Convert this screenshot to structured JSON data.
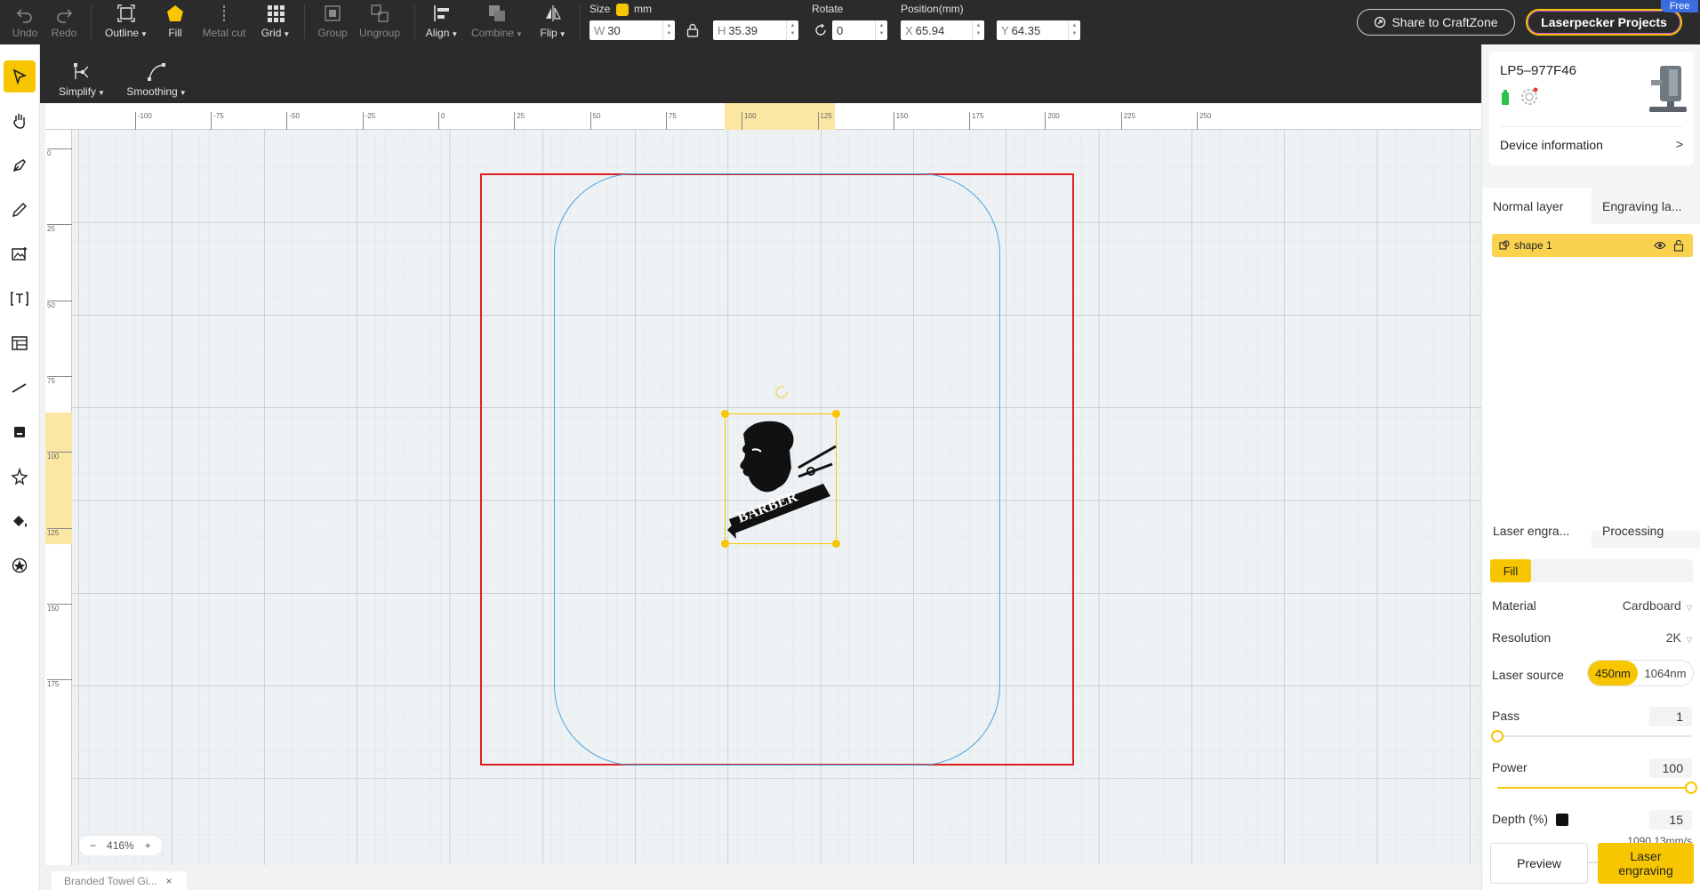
{
  "toolbar": {
    "undo": "Undo",
    "redo": "Redo",
    "outline": "Outline",
    "fill": "Fill",
    "metal_cut": "Metal cut",
    "grid": "Grid",
    "group": "Group",
    "ungroup": "Ungroup",
    "align": "Align",
    "combine": "Combine",
    "flip": "Flip",
    "size_label": "Size",
    "size_unit": "mm",
    "width_prefix": "W",
    "width_value": "30",
    "height_prefix": "H",
    "height_value": "35.39",
    "rotate_label": "Rotate",
    "rotate_value": "0",
    "position_label": "Position(mm)",
    "x_prefix": "X",
    "x_value": "65.94",
    "y_prefix": "Y",
    "y_value": "64.35",
    "share_button": "Share to CraftZone",
    "projects_button": "Laserpecker Projects",
    "free_badge": "Free"
  },
  "subtoolbar": {
    "simplify": "Simplify",
    "smoothing": "Smoothing"
  },
  "lefttools": [
    "select-icon",
    "hand-icon",
    "pen-icon",
    "pencil-icon",
    "image-icon",
    "text-icon",
    "table-icon",
    "line-icon",
    "stamp-icon",
    "magic-icon",
    "fill-bucket-icon",
    "shapes-icon"
  ],
  "ruler": {
    "x_ticks": [
      "-100",
      "-75",
      "-50",
      "-25",
      "0",
      "25",
      "50",
      "75",
      "100",
      "125",
      "150",
      "175",
      "200",
      "225",
      "250"
    ],
    "y_ticks": [
      "0",
      "25",
      "50",
      "75",
      "100",
      "125",
      "150",
      "175"
    ]
  },
  "artwork": {
    "text": "BARBER"
  },
  "zoom": {
    "minus": "−",
    "value": "416%",
    "plus": "+"
  },
  "file_tab": {
    "name": "Branded Towel Gi...",
    "close": "×"
  },
  "device": {
    "name": "LP5–977F46",
    "info_label": "Device information",
    "arrow": ">"
  },
  "layers": {
    "tabs": [
      "Normal layer",
      "Engraving la..."
    ],
    "items": [
      {
        "name": "shape 1"
      }
    ]
  },
  "settings": {
    "tabs": [
      "Laser engra...",
      "Processing"
    ],
    "mode": "Fill",
    "material_label": "Material",
    "material_value": "Cardboard",
    "resolution_label": "Resolution",
    "resolution_value": "2K",
    "laser_source_label": "Laser source",
    "laser_source_options": [
      "450nm",
      "1064nm"
    ],
    "pass_label": "Pass",
    "pass_value": "1",
    "power_label": "Power",
    "power_value": "100",
    "depth_label": "Depth (%)",
    "depth_value": "15",
    "speed": "1090.13mm/s",
    "preview_button": "Preview",
    "engrave_button": "Laser engraving",
    "pass_level": 0,
    "power_level": 1,
    "depth_level": 0.12
  },
  "colors": {
    "accent": "#f7c600",
    "workarea": "#e02020",
    "outline": "#4aa3df",
    "toolbar": "#2b2b2b"
  }
}
